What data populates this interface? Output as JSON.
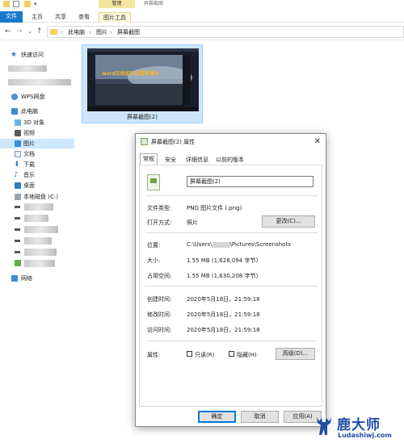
{
  "window": {
    "manage_tab": "管理",
    "title": "屏幕截图",
    "ribbon_tabs": [
      "文件",
      "主页",
      "共享",
      "查看",
      "图片工具"
    ]
  },
  "address": {
    "back": "←",
    "forward": "→",
    "recent": "⌄",
    "up": "↑",
    "crumbs": [
      "此电脑",
      "图片",
      "屏幕截图"
    ],
    "separator": "›"
  },
  "nav": {
    "quick_access": "快速访问",
    "wps": "WPS网盘",
    "this_pc": "此电脑",
    "objects_3d": "3D 对象",
    "videos": "视频",
    "pictures": "图片",
    "documents": "文档",
    "downloads": "下载",
    "music": "音乐",
    "desktop": "桌面",
    "local_disk": "本地磁盘 (C:)",
    "network": "网络"
  },
  "content": {
    "thumbnail_label": "屏幕截图(2)",
    "thumbnail_caption": "word文档如何设置背景色"
  },
  "dialog": {
    "title": "屏幕截图(2) 属性",
    "close": "✕",
    "tabs": [
      "常规",
      "安全",
      "详细信息",
      "以前的版本"
    ],
    "filename": "屏幕截图(2)",
    "file_type_label": "文件类型:",
    "file_type_value": "PNG 图片文件 (.png)",
    "opens_with_label": "打开方式:",
    "opens_with_value": "照片",
    "change_button": "更改(C)...",
    "location_label": "位置:",
    "location_prefix": "C:\\Users\\",
    "location_suffix": "\\Pictures\\Screenshots",
    "size_label": "大小:",
    "size_value": "1.55 MB (1,628,094 字节)",
    "size_on_disk_label": "占用空间:",
    "size_on_disk_value": "1.55 MB (1,630,208 字节)",
    "created_label": "创建时间:",
    "created_value": "2020年5月18日，21:59:18",
    "modified_label": "修改时间:",
    "modified_value": "2020年5月18日，21:59:18",
    "accessed_label": "访问时间:",
    "accessed_value": "2020年5月18日，21:59:18",
    "attributes_label": "属性:",
    "readonly_label": "只读(R)",
    "hidden_label": "隐藏(H)",
    "advanced_button": "高级(D)...",
    "ok": "确定",
    "cancel": "取消",
    "apply": "应用(A)"
  },
  "watermark": {
    "cn": "鹿大师",
    "en": "Ludashiwj.com"
  },
  "colors": {
    "file_tab": "#1979ca",
    "selection": "#cce8ff",
    "manage_tab": "#f3e6a0",
    "watermark": "#1f4da6"
  }
}
